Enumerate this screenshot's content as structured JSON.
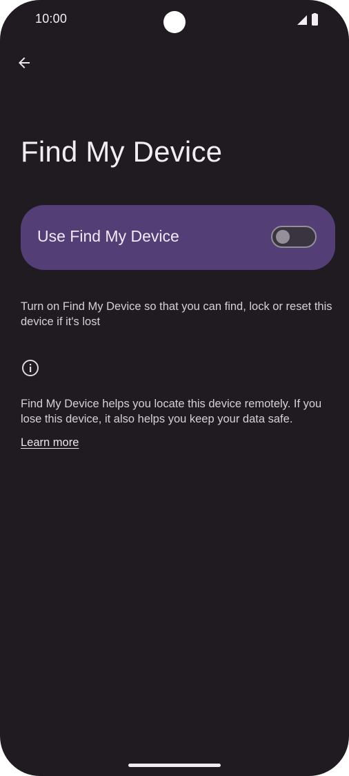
{
  "status_bar": {
    "time": "10:00",
    "signal_icon": "cellular-signal-icon",
    "battery_icon": "battery-icon"
  },
  "toolbar": {
    "back_icon": "arrow-back-icon"
  },
  "page": {
    "title": "Find My Device"
  },
  "main_switch": {
    "label": "Use Find My Device",
    "enabled": false
  },
  "description": "Turn on Find My Device so that you can find, lock or reset this device if it's lost",
  "info": {
    "icon": "info-icon",
    "text": "Find My Device helps you locate this device remotely. If you lose this device, it also helps you keep your data safe.",
    "link_label": "Learn more"
  },
  "colors": {
    "background": "#1f1b21",
    "switch_bar": "#543e76",
    "toggle_outline": "#958f99",
    "text_primary": "#f3edf3",
    "text_secondary": "#d7d0d8"
  }
}
